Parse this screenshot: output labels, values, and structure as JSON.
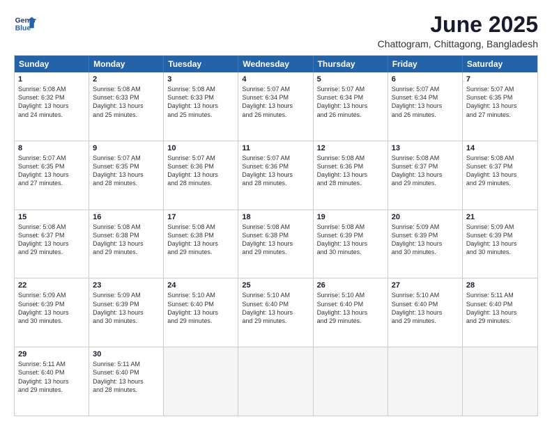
{
  "header": {
    "logo_line1": "General",
    "logo_line2": "Blue",
    "month_title": "June 2025",
    "location": "Chattogram, Chittagong, Bangladesh"
  },
  "weekdays": [
    "Sunday",
    "Monday",
    "Tuesday",
    "Wednesday",
    "Thursday",
    "Friday",
    "Saturday"
  ],
  "rows": [
    [
      {
        "day": "1",
        "lines": [
          "Sunrise: 5:08 AM",
          "Sunset: 6:32 PM",
          "Daylight: 13 hours",
          "and 24 minutes."
        ]
      },
      {
        "day": "2",
        "lines": [
          "Sunrise: 5:08 AM",
          "Sunset: 6:33 PM",
          "Daylight: 13 hours",
          "and 25 minutes."
        ]
      },
      {
        "day": "3",
        "lines": [
          "Sunrise: 5:08 AM",
          "Sunset: 6:33 PM",
          "Daylight: 13 hours",
          "and 25 minutes."
        ]
      },
      {
        "day": "4",
        "lines": [
          "Sunrise: 5:07 AM",
          "Sunset: 6:34 PM",
          "Daylight: 13 hours",
          "and 26 minutes."
        ]
      },
      {
        "day": "5",
        "lines": [
          "Sunrise: 5:07 AM",
          "Sunset: 6:34 PM",
          "Daylight: 13 hours",
          "and 26 minutes."
        ]
      },
      {
        "day": "6",
        "lines": [
          "Sunrise: 5:07 AM",
          "Sunset: 6:34 PM",
          "Daylight: 13 hours",
          "and 26 minutes."
        ]
      },
      {
        "day": "7",
        "lines": [
          "Sunrise: 5:07 AM",
          "Sunset: 6:35 PM",
          "Daylight: 13 hours",
          "and 27 minutes."
        ]
      }
    ],
    [
      {
        "day": "8",
        "lines": [
          "Sunrise: 5:07 AM",
          "Sunset: 6:35 PM",
          "Daylight: 13 hours",
          "and 27 minutes."
        ]
      },
      {
        "day": "9",
        "lines": [
          "Sunrise: 5:07 AM",
          "Sunset: 6:35 PM",
          "Daylight: 13 hours",
          "and 28 minutes."
        ]
      },
      {
        "day": "10",
        "lines": [
          "Sunrise: 5:07 AM",
          "Sunset: 6:36 PM",
          "Daylight: 13 hours",
          "and 28 minutes."
        ]
      },
      {
        "day": "11",
        "lines": [
          "Sunrise: 5:07 AM",
          "Sunset: 6:36 PM",
          "Daylight: 13 hours",
          "and 28 minutes."
        ]
      },
      {
        "day": "12",
        "lines": [
          "Sunrise: 5:08 AM",
          "Sunset: 6:36 PM",
          "Daylight: 13 hours",
          "and 28 minutes."
        ]
      },
      {
        "day": "13",
        "lines": [
          "Sunrise: 5:08 AM",
          "Sunset: 6:37 PM",
          "Daylight: 13 hours",
          "and 29 minutes."
        ]
      },
      {
        "day": "14",
        "lines": [
          "Sunrise: 5:08 AM",
          "Sunset: 6:37 PM",
          "Daylight: 13 hours",
          "and 29 minutes."
        ]
      }
    ],
    [
      {
        "day": "15",
        "lines": [
          "Sunrise: 5:08 AM",
          "Sunset: 6:37 PM",
          "Daylight: 13 hours",
          "and 29 minutes."
        ]
      },
      {
        "day": "16",
        "lines": [
          "Sunrise: 5:08 AM",
          "Sunset: 6:38 PM",
          "Daylight: 13 hours",
          "and 29 minutes."
        ]
      },
      {
        "day": "17",
        "lines": [
          "Sunrise: 5:08 AM",
          "Sunset: 6:38 PM",
          "Daylight: 13 hours",
          "and 29 minutes."
        ]
      },
      {
        "day": "18",
        "lines": [
          "Sunrise: 5:08 AM",
          "Sunset: 6:38 PM",
          "Daylight: 13 hours",
          "and 29 minutes."
        ]
      },
      {
        "day": "19",
        "lines": [
          "Sunrise: 5:08 AM",
          "Sunset: 6:39 PM",
          "Daylight: 13 hours",
          "and 30 minutes."
        ]
      },
      {
        "day": "20",
        "lines": [
          "Sunrise: 5:09 AM",
          "Sunset: 6:39 PM",
          "Daylight: 13 hours",
          "and 30 minutes."
        ]
      },
      {
        "day": "21",
        "lines": [
          "Sunrise: 5:09 AM",
          "Sunset: 6:39 PM",
          "Daylight: 13 hours",
          "and 30 minutes."
        ]
      }
    ],
    [
      {
        "day": "22",
        "lines": [
          "Sunrise: 5:09 AM",
          "Sunset: 6:39 PM",
          "Daylight: 13 hours",
          "and 30 minutes."
        ]
      },
      {
        "day": "23",
        "lines": [
          "Sunrise: 5:09 AM",
          "Sunset: 6:39 PM",
          "Daylight: 13 hours",
          "and 30 minutes."
        ]
      },
      {
        "day": "24",
        "lines": [
          "Sunrise: 5:10 AM",
          "Sunset: 6:40 PM",
          "Daylight: 13 hours",
          "and 29 minutes."
        ]
      },
      {
        "day": "25",
        "lines": [
          "Sunrise: 5:10 AM",
          "Sunset: 6:40 PM",
          "Daylight: 13 hours",
          "and 29 minutes."
        ]
      },
      {
        "day": "26",
        "lines": [
          "Sunrise: 5:10 AM",
          "Sunset: 6:40 PM",
          "Daylight: 13 hours",
          "and 29 minutes."
        ]
      },
      {
        "day": "27",
        "lines": [
          "Sunrise: 5:10 AM",
          "Sunset: 6:40 PM",
          "Daylight: 13 hours",
          "and 29 minutes."
        ]
      },
      {
        "day": "28",
        "lines": [
          "Sunrise: 5:11 AM",
          "Sunset: 6:40 PM",
          "Daylight: 13 hours",
          "and 29 minutes."
        ]
      }
    ],
    [
      {
        "day": "29",
        "lines": [
          "Sunrise: 5:11 AM",
          "Sunset: 6:40 PM",
          "Daylight: 13 hours",
          "and 29 minutes."
        ]
      },
      {
        "day": "30",
        "lines": [
          "Sunrise: 5:11 AM",
          "Sunset: 6:40 PM",
          "Daylight: 13 hours",
          "and 28 minutes."
        ]
      },
      {
        "day": "",
        "lines": []
      },
      {
        "day": "",
        "lines": []
      },
      {
        "day": "",
        "lines": []
      },
      {
        "day": "",
        "lines": []
      },
      {
        "day": "",
        "lines": []
      }
    ]
  ]
}
